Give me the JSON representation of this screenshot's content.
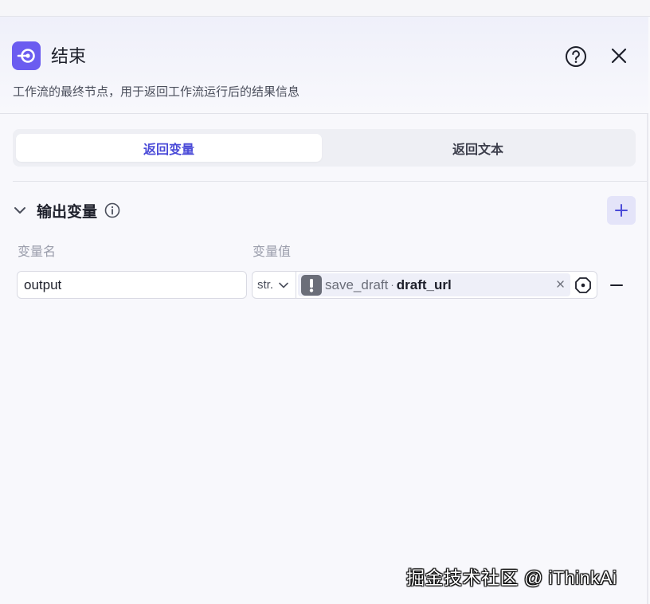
{
  "node": {
    "icon": "end-node-icon",
    "title": "结束",
    "description": "工作流的最终节点，用于返回工作流运行后的结果信息",
    "accent": "#6b5cf0"
  },
  "header": {
    "help_icon": "help-icon",
    "close_icon": "close-icon"
  },
  "tabs": [
    {
      "label": "返回变量",
      "active": true
    },
    {
      "label": "返回文本",
      "active": false
    }
  ],
  "section": {
    "title": "输出变量",
    "info_icon": "info-icon",
    "add_icon": "plus-icon",
    "collapse_icon": "chevron-down-icon"
  },
  "columns": {
    "name": "变量名",
    "value": "变量值"
  },
  "rows": [
    {
      "name": "output",
      "type": "str.",
      "ref_node": "save_draft",
      "ref_sep": "·",
      "ref_var": "draft_url",
      "warning_icon": "warning-icon"
    }
  ],
  "watermark": "掘金技术社区 @ iThinkAi",
  "colors": {
    "active_tab": "#4b4bd8",
    "add_button_bg": "#e4e4f9"
  }
}
